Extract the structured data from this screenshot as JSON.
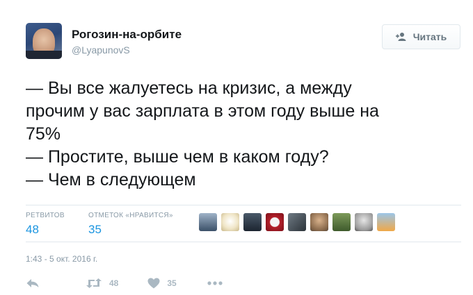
{
  "tweet": {
    "display_name": "Рогозин-на-орбите",
    "handle": "@LyapunovS",
    "follow_label": "Читать",
    "lines": [
      "— Вы все жалуетесь на кризис, а между",
      "прочим у вас зарплата в этом году выше на",
      "75%",
      "— Простите, выше чем в каком году?",
      "— Чем в следующем"
    ],
    "retweets_label": "РЕТВИТОВ",
    "retweets_count": "48",
    "likes_label": "ОТМЕТОК «НРАВИТСЯ»",
    "likes_count": "35",
    "timestamp": "1:43 - 5 окт. 2016 г.",
    "actions": {
      "retweet_count": "48",
      "like_count": "35"
    }
  },
  "colors": {
    "link_blue": "#1b95e0",
    "muted_gray": "#8899a6",
    "action_gray": "#aab8c2",
    "divider": "#e1e8ed"
  },
  "icons": [
    "follow-person-plus-icon",
    "reply-icon",
    "retweet-icon",
    "heart-icon",
    "more-dots-icon"
  ]
}
